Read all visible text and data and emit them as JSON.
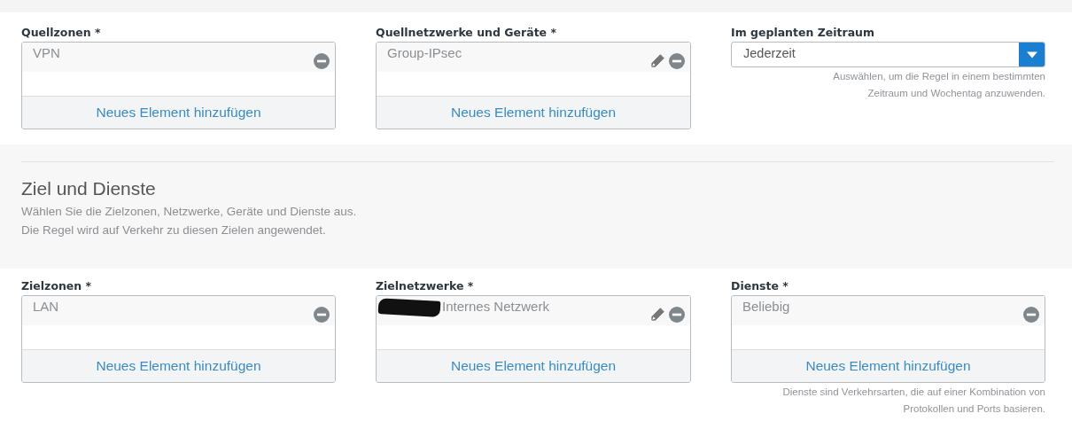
{
  "source_fields": [
    {
      "label": "Quellzonen *",
      "items": [
        {
          "text": "VPN",
          "editable": false,
          "redacted": false
        }
      ],
      "add_link": "Neues Element hinzufügen"
    },
    {
      "label": "Quellnetzwerke und Geräte *",
      "items": [
        {
          "text": "Group-IPsec",
          "editable": true,
          "redacted": false
        }
      ],
      "add_link": "Neues Element hinzufügen"
    }
  ],
  "schedule": {
    "label": "Im geplanten Zeitraum",
    "value": "Jederzeit",
    "hint": "Auswählen, um die Regel in einem bestimmten Zeitraum und Wochentag anzuwenden."
  },
  "section": {
    "title": "Ziel und Dienste",
    "descriptions": [
      "Wählen Sie die Zielzonen, Netzwerke, Geräte und Dienste aus.",
      "Die Regel wird auf Verkehr zu diesen Zielen angewendet."
    ]
  },
  "dest_fields": [
    {
      "label": "Zielzonen *",
      "items": [
        {
          "text": "LAN",
          "editable": false,
          "redacted": false
        }
      ],
      "add_link": "Neues Element hinzufügen"
    },
    {
      "label": "Zielnetzwerke *",
      "items": [
        {
          "text": "Internes Netzwerk",
          "editable": true,
          "redacted": true
        }
      ],
      "add_link": "Neues Element hinzufügen"
    },
    {
      "label": "Dienste *",
      "items": [
        {
          "text": "Beliebig",
          "editable": false,
          "redacted": false
        }
      ],
      "add_link": "Neues Element hinzufügen",
      "hint": "Dienste sind Verkehrsarten, die auf einer Kombination von Protokollen und Ports basieren."
    }
  ]
}
